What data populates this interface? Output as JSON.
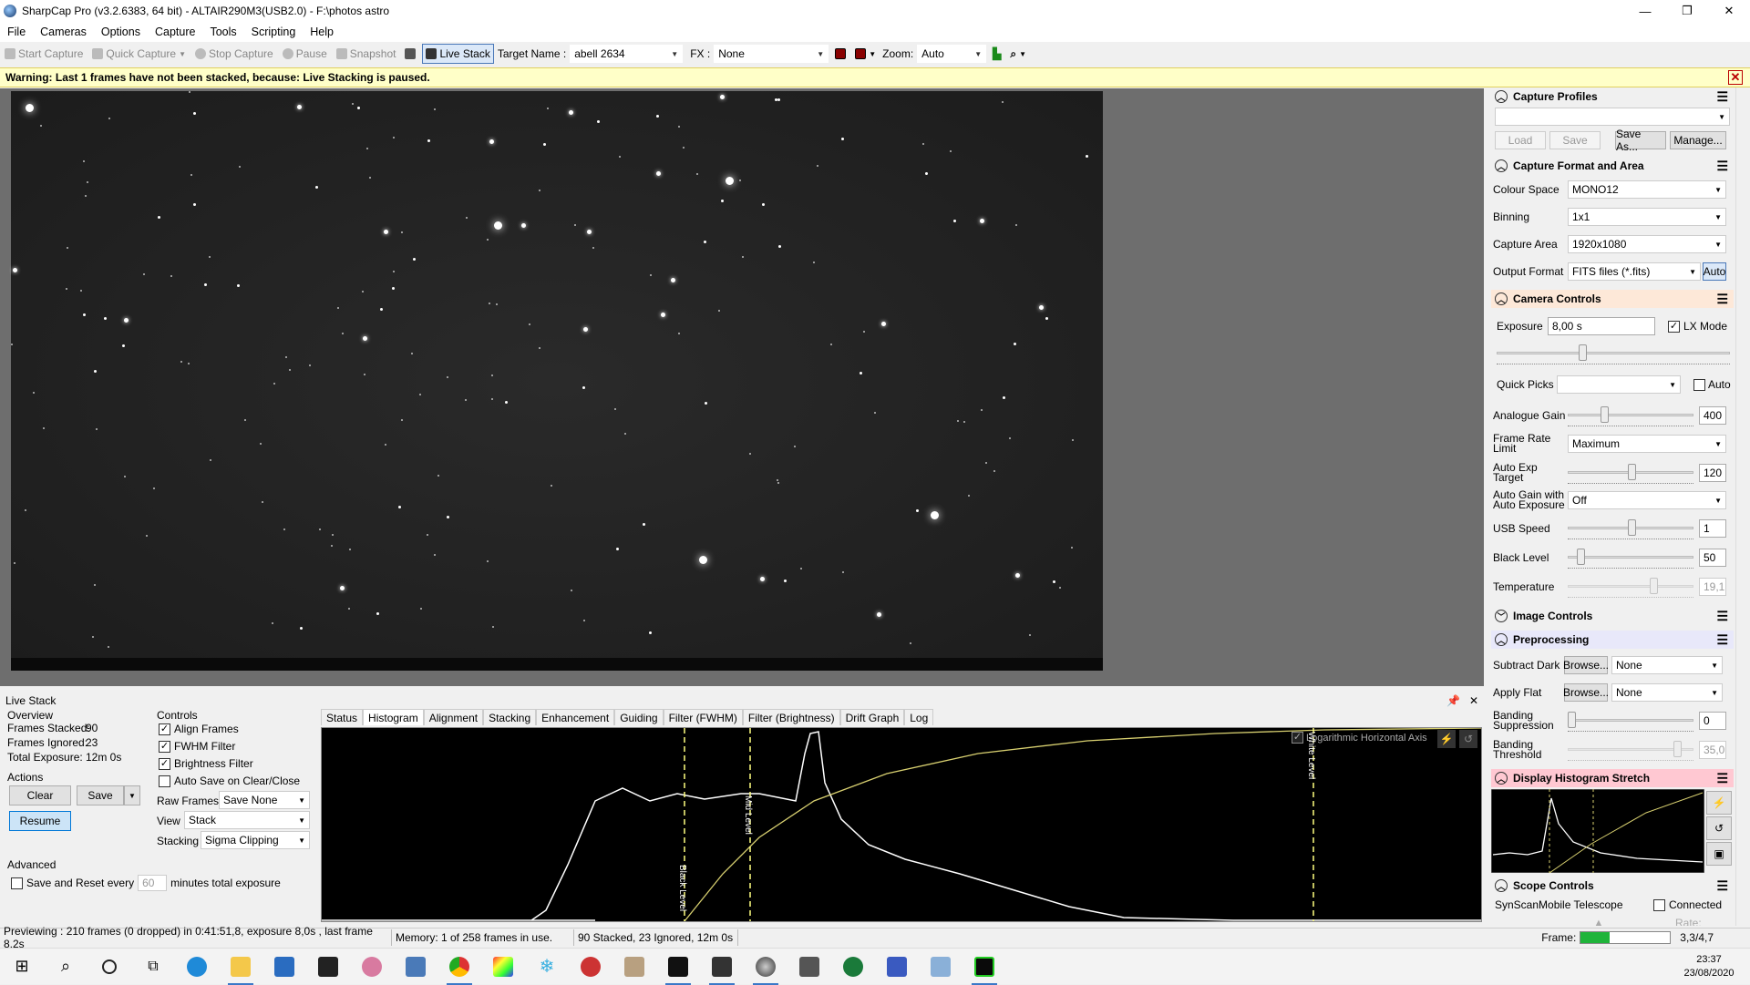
{
  "window": {
    "title": "SharpCap Pro (v3.2.6383, 64 bit) - ALTAIR290M3(USB2.0) - F:\\photos astro",
    "controls": [
      "—",
      "❐",
      "✕"
    ]
  },
  "menu": [
    "File",
    "Cameras",
    "Options",
    "Capture",
    "Tools",
    "Scripting",
    "Help"
  ],
  "toolbar": {
    "start_capture": "Start Capture",
    "quick_capture": "Quick Capture",
    "stop_capture": "Stop Capture",
    "pause": "Pause",
    "snapshot": "Snapshot",
    "live_stack": "Live Stack",
    "target_label": "Target Name :",
    "target_value": "abell 2634",
    "fx_label": "FX :",
    "fx_value": "None",
    "zoom_label": "Zoom:",
    "zoom_value": "Auto"
  },
  "warning": "Warning: Last 1 frames have not been stacked, because: Live Stacking is paused.",
  "capture_profiles": {
    "header": "Capture Profiles",
    "profile_value": "",
    "load": "Load",
    "save": "Save",
    "save_as": "Save As...",
    "manage": "Manage..."
  },
  "capture_format": {
    "header": "Capture Format and Area",
    "colour_space_label": "Colour Space",
    "colour_space": "MONO12",
    "binning_label": "Binning",
    "binning": "1x1",
    "capture_area_label": "Capture Area",
    "capture_area": "1920x1080",
    "output_format_label": "Output Format",
    "output_format": "FITS files (*.fits)",
    "auto": "Auto"
  },
  "camera_controls": {
    "header": "Camera Controls",
    "exposure_label": "Exposure",
    "exposure": "8,00 s",
    "lx_mode": "LX Mode",
    "quick_picks_label": "Quick Picks",
    "quick_picks": "",
    "auto_label": "Auto",
    "analogue_gain_label": "Analogue Gain",
    "analogue_gain": "400",
    "frame_rate_label": "Frame Rate Limit",
    "frame_rate": "Maximum",
    "auto_exp_target_label": "Auto Exp Target",
    "auto_exp_target": "120",
    "auto_gain_label": "Auto Gain with Auto Exposure",
    "auto_gain": "Off",
    "usb_speed_label": "USB Speed",
    "usb_speed": "1",
    "black_level_label": "Black Level",
    "black_level": "50",
    "temperature_label": "Temperature",
    "temperature": "19,1"
  },
  "image_controls": {
    "header": "Image Controls"
  },
  "preprocessing": {
    "header": "Preprocessing",
    "subtract_dark_label": "Subtract Dark",
    "browse": "Browse...",
    "subtract_dark": "None",
    "apply_flat_label": "Apply Flat",
    "apply_flat": "None",
    "banding_suppression_label": "Banding Suppression",
    "banding_suppression": "0",
    "banding_threshold_label": "Banding Threshold",
    "banding_threshold": "35,0"
  },
  "display_stretch": {
    "header": "Display Histogram Stretch"
  },
  "scope_controls": {
    "header": "Scope Controls",
    "scope": "SynScanMobile Telescope",
    "connected": "Connected",
    "rate": "Rate:"
  },
  "live_stack": {
    "title": "Live Stack",
    "overview": "Overview",
    "frames_stacked_label": "Frames Stacked:",
    "frames_stacked": "90",
    "frames_ignored_label": "Frames Ignored:",
    "frames_ignored": "23",
    "total_exposure_label": "Total Exposure:",
    "total_exposure": "12m 0s",
    "actions": "Actions",
    "clear": "Clear",
    "save": "Save",
    "resume": "Resume",
    "controls": "Controls",
    "align_frames": "Align Frames",
    "fwhm_filter": "FWHM Filter",
    "brightness_filter": "Brightness Filter",
    "auto_save": "Auto Save on Clear/Close",
    "raw_frames_label": "Raw Frames",
    "raw_frames": "Save None",
    "view_label": "View",
    "view": "Stack",
    "stacking_label": "Stacking",
    "stacking": "Sigma Clipping",
    "advanced": "Advanced",
    "save_reset_label": "Save and Reset every",
    "save_reset_value": "60",
    "save_reset_suffix": "minutes total exposure",
    "tabs": [
      "Status",
      "Histogram",
      "Alignment",
      "Stacking",
      "Enhancement",
      "Guiding",
      "Filter (FWHM)",
      "Filter (Brightness)",
      "Drift Graph",
      "Log"
    ],
    "selected_tab": "Histogram",
    "log_axis_label": "Logarithmic Horizontal Axis",
    "black_level_marker": "Black Level",
    "mid_level_marker": "Mid Level",
    "white_level_marker": "White Level"
  },
  "status": {
    "previewing": "Previewing : 210 frames (0 dropped) in 0:41:51,8, exposure 8,0s , last frame 8,2s",
    "memory": "Memory: 1 of 258 frames in use.",
    "stacked": "90 Stacked, 23 Ignored, 12m 0s",
    "frame_label": "Frame:",
    "frame_value": "3,3/4,7"
  },
  "clock": {
    "time": "23:37",
    "date": "23/08/2020"
  },
  "colors": {
    "accent": "#3a78c8",
    "warning_bg": "#ffffc8",
    "stretch_header": "#ffc8d2",
    "camera_header": "#fde8d8",
    "preproc_header": "#e8e8fa",
    "curve": "#d8d070"
  }
}
